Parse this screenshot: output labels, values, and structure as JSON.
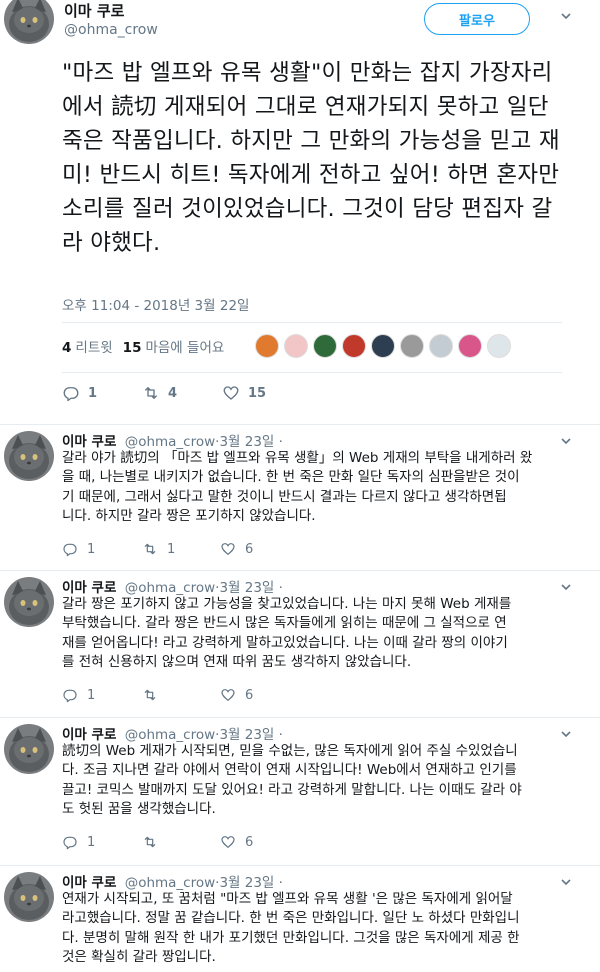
{
  "main": {
    "name": "이마 쿠로",
    "handle": "@ohma_crow",
    "follow_label": "팔로우",
    "text": "\"마즈 밥 엘프와 유목 생활\"이 만화는 잡지 가장자리에서 読切 게재되어 그대로 연재가되지 못하고 일단 죽은 작품입니다. 하지만 그 만화의 가능성을 믿고 재미! 반드시 히트! 독자에게 전하고 싶어! 하면 혼자만 소리를 질러 것이있었습니다. 그것이 담당 편집자 갈라 야했다.",
    "timestamp": "오후 11:04 - 2018년 3월 22일",
    "retweets_count": "4",
    "retweets_label": "리트윗",
    "likes_count": "15",
    "likes_label": "마음에 들어요",
    "reply_count": "1",
    "retweet_action_count": "4",
    "like_action_count": "15"
  },
  "likers": [
    {
      "icon": "avatar-orange",
      "color": "#e07a2e"
    },
    {
      "icon": "avatar-pink-face",
      "color": "#f2c6c6"
    },
    {
      "icon": "avatar-green-forest",
      "color": "#2f6b3a"
    },
    {
      "icon": "avatar-red-cartoon",
      "color": "#c0392b"
    },
    {
      "icon": "avatar-dark-cartoon",
      "color": "#2c3e50"
    },
    {
      "icon": "avatar-sketch",
      "color": "#9a9a9a"
    },
    {
      "icon": "avatar-default",
      "color": "#c4ccd3"
    },
    {
      "icon": "avatar-anime-pink",
      "color": "#d9568a"
    },
    {
      "icon": "avatar-white-cat",
      "color": "#dfe6ea"
    }
  ],
  "replies": [
    {
      "name": "이마 쿠로",
      "handle": "@ohma_crow",
      "date": "3월 23일",
      "lines": [
        "갈라 야가 読切의 「마즈 밥 엘프와 유목 생활」의 Web 게재의 부탁을 내게하러 왔",
        "을 때, 나는별로 내키지가 없습니다. 한 번 죽은 만화 일단 독자의 심판을받은 것이",
        "기 때문에, 그래서 싫다고 말한 것이니 반드시 결과는 다르지 않다고 생각하면됩",
        "니다. 하지만 갈라 짱은 포기하지 않았습니다."
      ],
      "reply_count": "1",
      "retweet_count": "1",
      "like_count": "6"
    },
    {
      "name": "이마 쿠로",
      "handle": "@ohma_crow",
      "date": "3월 23일",
      "lines": [
        "갈라 짱은 포기하지 않고 가능성을 찾고있었습니다. 나는 마지 못해 Web 게재를",
        "부탁했습니다. 갈라 짱은 반드시 많은 독자들에게 읽히는 때문에 그 실적으로 연",
        "재를 얻어옵니다! 라고 강력하게 말하고있었습니다. 나는 이때 갈라 짱의 이야기",
        "를 전혀 신용하지 않으며 연재 따위 꿈도 생각하지 않았습니다."
      ],
      "reply_count": "1",
      "retweet_count": "",
      "like_count": "6"
    },
    {
      "name": "이마 쿠로",
      "handle": "@ohma_crow",
      "date": "3월 23일",
      "lines": [
        "読切의 Web 게재가 시작되면, 믿을 수없는, 많은 독자에게 읽어 주실 수있었습니",
        "다. 조금 지나면 갈라 야에서 연락이 연재 시작입니다! Web에서 연재하고 인기를",
        "끌고! 코믹스 발매까지 도달 있어요! 라고 강력하게 말합니다. 나는 이때도 갈라 야",
        "도 헛된 꿈을 생각했습니다."
      ],
      "reply_count": "1",
      "retweet_count": "",
      "like_count": "6"
    },
    {
      "name": "이마 쿠로",
      "handle": "@ohma_crow",
      "date": "3월 23일",
      "lines": [
        "연재가 시작되고, 또 꿈처럼 \"마즈 밥 엘프와 유목 생활 '은 많은 독자에게 읽어달",
        "라고했습니다. 정말 꿈 같습니다. 한 번 죽은 만화입니다. 일단 노 하셨다 만화입니",
        "다. 분명히 말해 원작 한 내가 포기했던 만화입니다. 그것을 많은 독자에게 제공 한",
        "것은 확실히 갈라 짱입니다."
      ],
      "reply_count": "",
      "retweet_count": "",
      "like_count": ""
    }
  ],
  "colors": {
    "accent": "#1da1f2",
    "secondary_text": "#657786",
    "primary_text": "#14171a",
    "divider": "#e6ecf0"
  },
  "icons": {
    "reply": "reply-icon",
    "retweet": "retweet-icon",
    "like": "heart-icon",
    "caret": "chevron-down-icon"
  }
}
